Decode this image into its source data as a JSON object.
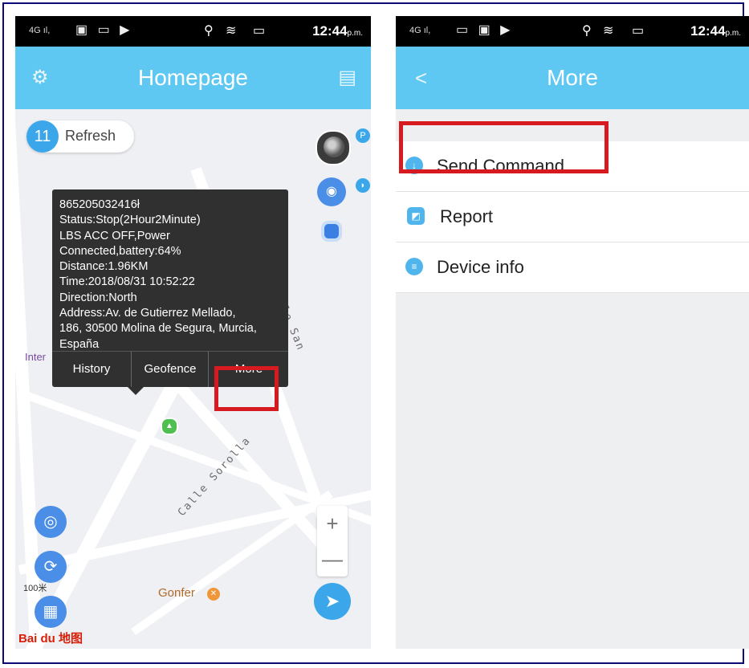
{
  "left": {
    "status_bar": {
      "network": "4G ıl,",
      "time": "12:44",
      "ampm": "p.m."
    },
    "title": "Homepage",
    "settings_icon": "gear-icon",
    "message_icon": "message-icon",
    "refresh": {
      "count": "11",
      "label": "Refresh"
    },
    "popup": {
      "lines": [
        "865205032416ł",
        "Status:Stop(2Hour2Minute)",
        "LBS ACC OFF,Power",
        "Connected,battery:64%",
        "Distance:1.96KM",
        "Time:2018/08/31 10:52:22",
        "Direction:North",
        "Address:Av. de Gutierrez Mellado,",
        "186, 30500 Molina de Segura, Murcia,",
        "España"
      ],
      "buttons": {
        "history": "History",
        "geofence": "Geofence",
        "more": "More"
      }
    },
    "map_labels": {
      "street1": "Calle San Rafael",
      "street2": "Calle Sorolla",
      "inter": "Inter",
      "gonfer": "Gonfer",
      "scale": "100米",
      "baidu": "Bai du 地图"
    },
    "zoom": {
      "plus": "+",
      "minus": "—"
    }
  },
  "right": {
    "status_bar": {
      "network": "4G ıl,",
      "time": "12:44",
      "ampm": "p.m."
    },
    "title": "More",
    "back": "<",
    "items": [
      {
        "label": "Send Command",
        "icon": "download-icon"
      },
      {
        "label": "Report",
        "icon": "report-icon"
      },
      {
        "label": "Device info",
        "icon": "info-icon"
      }
    ]
  },
  "highlight_color": "#d71920",
  "accent_color": "#5ec8f2"
}
